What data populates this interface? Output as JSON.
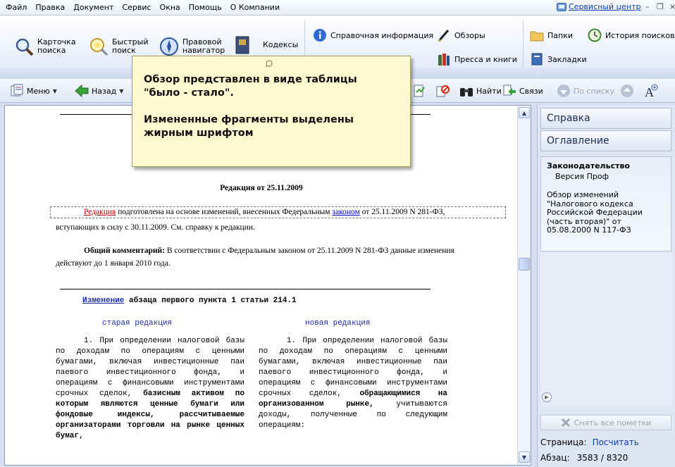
{
  "menu": [
    "Файл",
    "Правка",
    "Документ",
    "Сервис",
    "Окна",
    "Помощь",
    "О Компании"
  ],
  "service_center": "Сервисный центр",
  "ribbon": {
    "card_search": [
      "Карточка",
      "поиска"
    ],
    "quick_search": [
      "Быстрый",
      "поиск"
    ],
    "legal_navigator": [
      "Правовой",
      "навигатор"
    ],
    "codes": "Кодексы",
    "reference_info": "Справочная информация",
    "reviews": "Обзоры",
    "press_books": "Пресса и книги",
    "folders": "Папки",
    "search_history": "История поисков",
    "bookmarks": "Закладки"
  },
  "toolbar": {
    "menu": "Меню",
    "back": "Назад",
    "find": "Найти",
    "links": "Связи",
    "by_list": "По списку"
  },
  "tooltip": {
    "line1": "Обзор представлен в виде таблицы",
    "line2": "\"было - стало\".",
    "line3": "Измененные фрагменты выделены",
    "line4": "жирным шрифтом"
  },
  "document": {
    "edition_title": "Редакция от 25.11.2009",
    "edition_link": "Редакция",
    "edition_text_1": " подготовлена на основе изменений, внесенных Федеральным ",
    "edition_law_link": "законом",
    "edition_text_2": " от 25.11.2009 N 281-ФЗ,",
    "edition_line_2": "вступающих в силу с 30.11.2009. См. справку к редакции.",
    "comment_label": "Общий комментарий:",
    "comment_text_1": " В соответствии с Федеральным законом от 25.11.2009 N 281-ФЗ данные изменения",
    "comment_line_2": "действуют до 1 января 2010 года.",
    "change_link": "Изменение",
    "change_text": " абзаца первого пункта 1 статьи 214.1",
    "old_heading": "старая редакция",
    "new_heading": "новая редакция",
    "old_normal": "1. При определении налоговой базы по доходам по операциям с ценными бумагами, включая инвестиционные паи паевого инвестиционного фонда, и операциям с финансовыми инструментами срочных сделок,",
    "old_bold": "базисным активом по которым являются ценные бумаги или фондовые индексы, рассчитываемые организаторами торговли на рынке ценных бумаг,",
    "new_normal_1": "1. При определении налоговой базы по доходам по операциям с ценными бумагами, включая инвестиционные паи паевого инвестиционного фонда, и операциям с финансовыми инструментами срочных сделок,",
    "new_bold": "обращающимися на организованном рынке,",
    "new_normal_2": "учитываются доходы, полученные по следующим операциям:"
  },
  "right_panel": {
    "tab_help": "Справка",
    "tab_contents": "Оглавление",
    "legislation": "Законодательство",
    "version": "Версия Проф",
    "description": "Обзор изменений \"Налогового кодекса Российской Федерации (часть вторая)\" от 05.08.2000 N 117-ФЗ",
    "clear_marks": "Снять все пометки",
    "page_label": "Страница:",
    "page_link": "Посчитать",
    "para_label": "Абзац:",
    "para_value": "3583 / 8320"
  }
}
